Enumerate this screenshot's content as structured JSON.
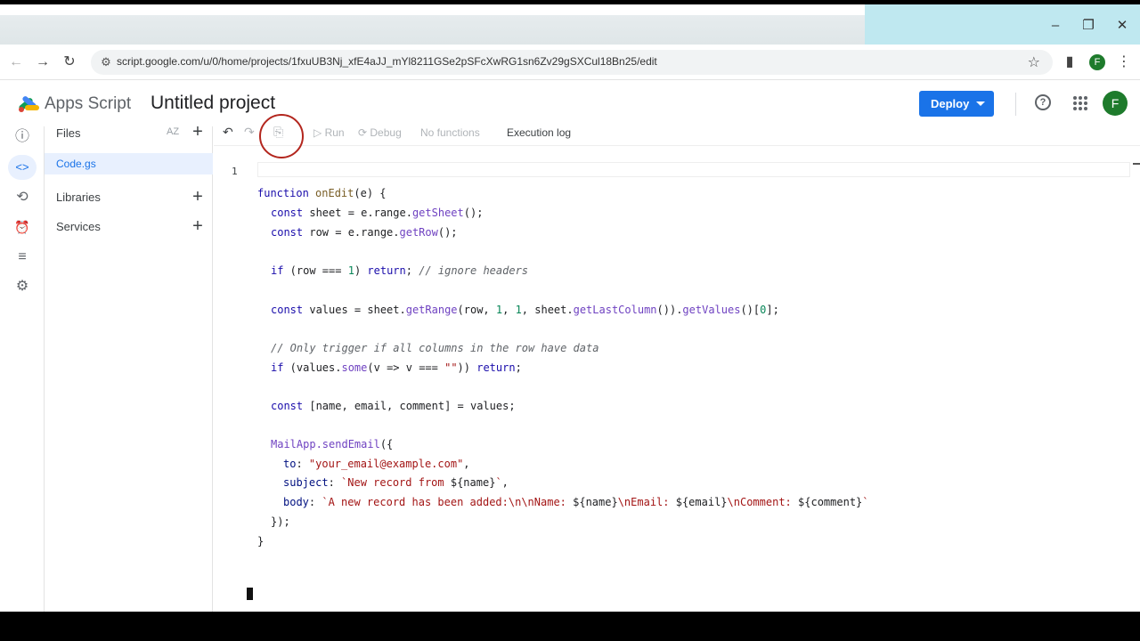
{
  "browser": {
    "url": "script.google.com/u/0/home/projects/1fxuUB3Nj_xfE4aJJ_mYl8211GSe2pSFcXwRG1sn6Zv29gSXCul18Bn25/edit",
    "profile_initial": "F",
    "window_controls": {
      "minimize": "–",
      "restore": "❐",
      "close": "✕"
    },
    "icons": {
      "back": "←",
      "forward": "→",
      "reload": "↻",
      "site_settings": "⚙",
      "bookmark": "☆",
      "side_panel": "▮",
      "menu": "⋮"
    }
  },
  "header": {
    "brand": "Apps Script",
    "project_title": "Untitled project",
    "deploy_label": "Deploy",
    "help_icon": "?",
    "apps_icon": "⋮⋮⋮",
    "user_initial": "F"
  },
  "rail": [
    {
      "name": "overview",
      "glyph": "ⓘ"
    },
    {
      "name": "editor",
      "glyph": "<>"
    },
    {
      "name": "executions",
      "glyph": "⟲"
    },
    {
      "name": "triggers",
      "glyph": "⏰"
    },
    {
      "name": "executions-list",
      "glyph": "≡"
    },
    {
      "name": "settings",
      "glyph": "⚙"
    }
  ],
  "files_panel": {
    "title": "Files",
    "sort_label": "AZ",
    "add_glyph": "+",
    "files": [
      "Code.gs"
    ],
    "libraries_label": "Libraries",
    "services_label": "Services"
  },
  "editor_toolbar": {
    "undo": "↶",
    "redo": "↷",
    "save_icon": "⎘",
    "run_label": "Run",
    "debug_label": "Debug",
    "function_select": "No functions",
    "execution_log_label": "Execution log"
  },
  "editor": {
    "line_number": "1",
    "code": {
      "l1_kw": "function",
      "l1_fn": "onEdit",
      "l1_rest": "(e) {",
      "l2_kw": "const",
      "l2_a": " sheet = e.range.",
      "l2_m": "getSheet",
      "l2_b": "();",
      "l3_kw": "const",
      "l3_a": " row = e.range.",
      "l3_m": "getRow",
      "l3_b": "();",
      "l4_kw1": "if",
      "l4_a": " (row === ",
      "l4_n": "1",
      "l4_b": ") ",
      "l4_kw2": "return",
      "l4_c": "; ",
      "l4_cmt": "// ignore headers",
      "l5_kw": "const",
      "l5_a": " values = sheet.",
      "l5_m1": "getRange",
      "l5_b": "(row, ",
      "l5_n1": "1",
      "l5_c": ", ",
      "l5_n2": "1",
      "l5_d": ", sheet.",
      "l5_m2": "getLastColumn",
      "l5_e": "()).",
      "l5_m3": "getValues",
      "l5_f": "()[",
      "l5_n3": "0",
      "l5_g": "];",
      "l6_cmt": "// Only trigger if all columns in the row have data",
      "l7_kw1": "if",
      "l7_a": " (values.",
      "l7_m": "some",
      "l7_b": "(v => v === ",
      "l7_s": "\"\"",
      "l7_c": ")) ",
      "l7_kw2": "return",
      "l7_d": ";",
      "l8_kw": "const",
      "l8_a": " [name, email, comment] = values;",
      "l9_m": "MailApp.sendEmail",
      "l9_a": "({",
      "l10_p": "to",
      "l10_a": ": ",
      "l10_s": "\"your_email@example.com\"",
      "l10_b": ",",
      "l11_p": "subject",
      "l11_a": ": ",
      "l11_s1": "`New record from ",
      "l11_v": "${name}",
      "l11_s2": "`",
      "l11_b": ",",
      "l12_p": "body",
      "l12_a": ": ",
      "l12_s1": "`A new record has been added:\\n\\nName: ",
      "l12_v1": "${name}",
      "l12_s2": "\\nEmail: ",
      "l12_v2": "${email}",
      "l12_s3": "\\nComment: ",
      "l12_v3": "${comment}",
      "l12_s4": "`",
      "l13": "});",
      "l14": "}"
    }
  }
}
